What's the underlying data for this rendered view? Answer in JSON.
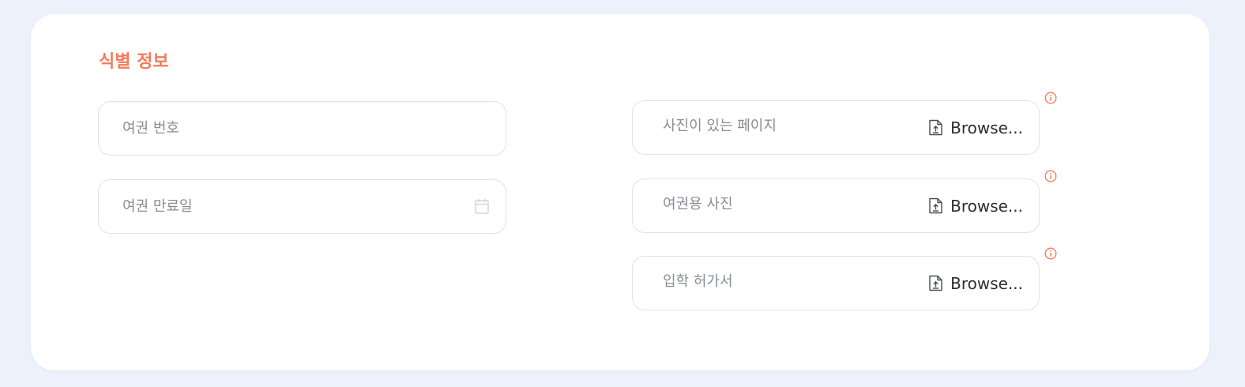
{
  "section": {
    "title": "식별 정보"
  },
  "left_fields": {
    "passport_number": {
      "placeholder": "여권 번호"
    },
    "passport_expiry": {
      "placeholder": "여권 만료일"
    }
  },
  "upload_fields": [
    {
      "placeholder": "사진이 있는 페이지",
      "button_label": "Browse..."
    },
    {
      "placeholder": "여권용 사진",
      "button_label": "Browse..."
    },
    {
      "placeholder": "입학 허가서",
      "button_label": "Browse..."
    }
  ],
  "colors": {
    "page_background": "#edf1fc",
    "accent": "#f47c5b",
    "field_border": "#dfe2e8",
    "placeholder_text": "#8a8d94"
  },
  "icons": {
    "calendar": "calendar-icon",
    "file_upload": "file-upload-icon",
    "info": "info-icon"
  }
}
